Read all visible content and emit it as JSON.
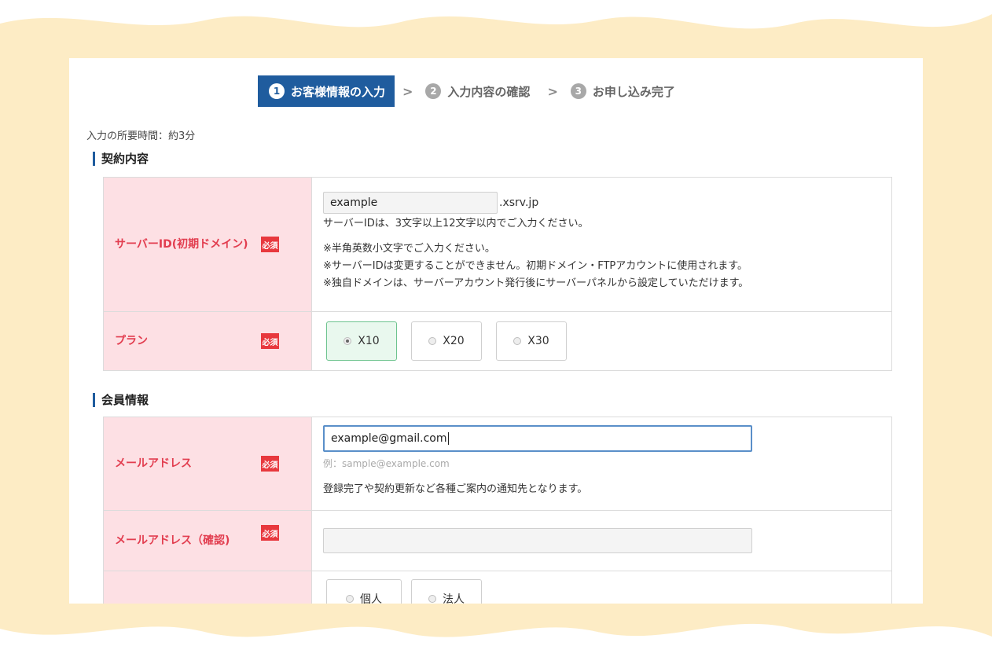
{
  "steps": [
    {
      "num": "1",
      "label": "お客様情報の入力"
    },
    {
      "num": "2",
      "label": "入力内容の確認"
    },
    {
      "num": "3",
      "label": "お申し込み完了"
    }
  ],
  "step_separator": ">",
  "duration_text": "入力の所要時間：約3分",
  "section_contract": {
    "title": "契約内容",
    "server_id": {
      "label": "サーバーID(初期ドメイン)",
      "required": "必須",
      "value": "example",
      "suffix": ".xsrv.jp",
      "note_length": "サーバーIDは、3文字以上12文字以内でご入力ください。",
      "notes": [
        "※半角英数小文字でご入力ください。",
        "※サーバーIDは変更することができません。初期ドメイン・FTPアカウントに使用されます。",
        "※独自ドメインは、サーバーアカウント発行後にサーバーパネルから設定していただけます。"
      ]
    },
    "plan": {
      "label": "プラン",
      "required": "必須",
      "options": [
        "X10",
        "X20",
        "X30"
      ],
      "selected": "X10"
    }
  },
  "section_member": {
    "title": "会員情報",
    "email": {
      "label": "メールアドレス",
      "required": "必須",
      "value": "example@gmail.com",
      "example": "例：sample@example.com",
      "note": "登録完了や契約更新など各種ご案内の通知先となります。"
    },
    "email_confirm": {
      "label": "メールアドレス（確認)",
      "required": "必須",
      "value": ""
    },
    "type_options": [
      "個人",
      "法人"
    ]
  },
  "colors": {
    "background": "#fdecc5",
    "accent_blue": "#1f5c9e",
    "label_bg": "#fde0e4",
    "label_text": "#e23d4f",
    "required_badge": "#e8383d",
    "selected_border": "#6dc38e"
  }
}
